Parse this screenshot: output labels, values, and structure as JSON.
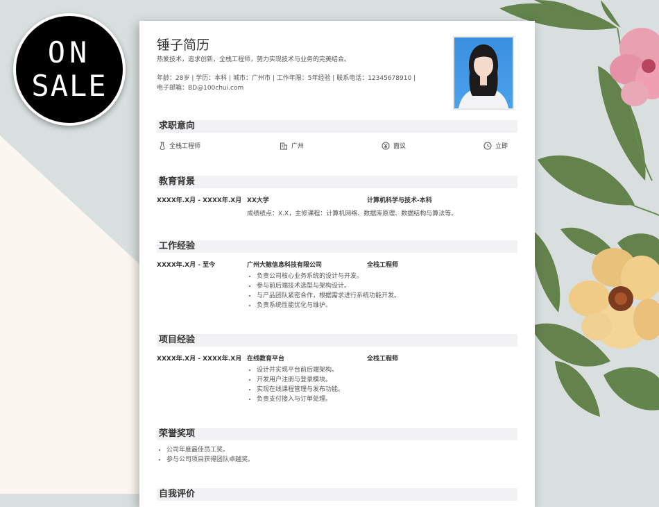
{
  "badge": {
    "line1": "ON",
    "line2": "SALE"
  },
  "resume": {
    "name": "锤子简历",
    "intro": "热爱技术，追求创新，全栈工程师，努力实现技术与业务的完美结合。",
    "info_line1": "年龄：28岁 | 学历：本科 | 城市：广州市 | 工作年限：5年经验 | 联系电话：12345678910 |",
    "info_line2": "电子邮箱：BD@100chui.com"
  },
  "sections": {
    "intent": "求职意向",
    "education": "教育背景",
    "work": "工作经验",
    "projects": "项目经验",
    "honors": "荣誉奖项",
    "self": "自我评价"
  },
  "intent": {
    "position": "全栈工程师",
    "city": "广州",
    "salary": "面议",
    "availability": "立即"
  },
  "education": {
    "date": "XXXX年.X月 - XXXX年.X月",
    "school": "XX大学",
    "major": "计算机科学与技术-本科",
    "detail": "成绩绩点：X.X，主修课程：计算机网络、数据库原理、数据结构与算法等。"
  },
  "work": {
    "date": "XXXX年.X月 - 至今",
    "company": "广州大鲸信息科技有限公司",
    "role": "全栈工程师",
    "items": [
      "负责公司核心业务系统的设计与开发。",
      "参与前后端技术选型与架构设计。",
      "与产品团队紧密合作，根据需求进行系统功能开发。",
      "负责系统性能优化与维护。"
    ]
  },
  "project": {
    "date": "XXXX年.X月 - XXXX年.X月",
    "name": "在线教育平台",
    "role": "全栈工程师",
    "items": [
      "设计并实现平台前后端架构。",
      "开发用户注册与登录模块。",
      "实现在线课程管理与发布功能。",
      "负责支付接入与订单处理。"
    ]
  },
  "honors": {
    "items": [
      "公司年度最佳员工奖。",
      "参与公司项目获得团队卓越奖。"
    ]
  },
  "colors": {
    "section_bg": "#f2f2f5",
    "badge_bg": "#000000",
    "background": "#d9dfdf"
  }
}
